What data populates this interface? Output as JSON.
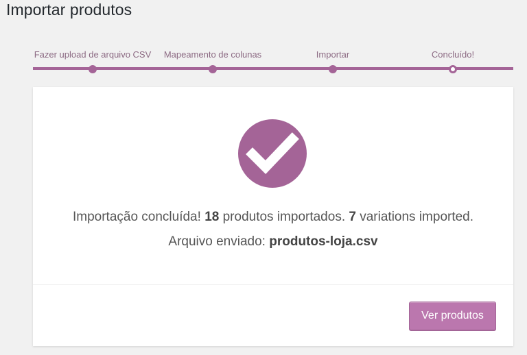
{
  "page": {
    "title": "Importar produtos"
  },
  "steps": {
    "items": [
      {
        "label": "Fazer upload de arquivo CSV",
        "state": "done"
      },
      {
        "label": "Mapeamento de colunas",
        "state": "done"
      },
      {
        "label": "Importar",
        "state": "done"
      },
      {
        "label": "Concluído!",
        "state": "current"
      }
    ]
  },
  "result": {
    "icon": "checkmark-icon",
    "line1_prefix": "Importação concluída! ",
    "products_count": "18",
    "line1_middle": " produtos importados. ",
    "variations_count": "7",
    "line1_suffix": " variations imported.",
    "line2_prefix": "Arquivo enviado: ",
    "file_name": "produtos-loja.csv"
  },
  "actions": {
    "view_products_label": "Ver produtos"
  },
  "colors": {
    "accent": "#a46497",
    "button": "#bb77ae",
    "background": "#f1f1f1"
  }
}
